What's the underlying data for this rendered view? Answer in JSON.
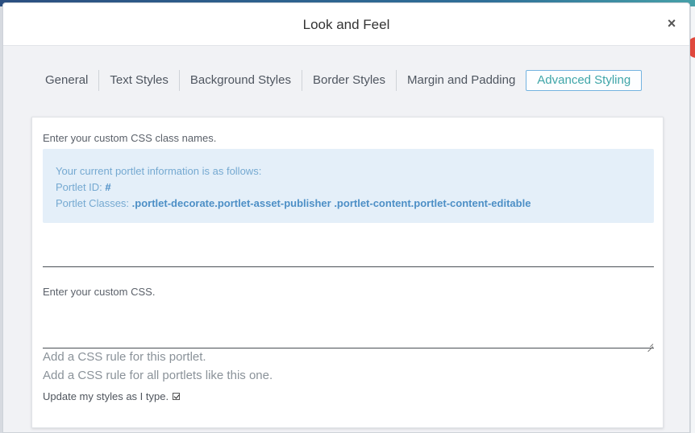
{
  "dialog": {
    "title": "Look and Feel",
    "close_label": "×"
  },
  "tabs": [
    {
      "label": "General",
      "active": false
    },
    {
      "label": "Text Styles",
      "active": false
    },
    {
      "label": "Background Styles",
      "active": false
    },
    {
      "label": "Border Styles",
      "active": false
    },
    {
      "label": "Margin and Padding",
      "active": false
    },
    {
      "label": "Advanced Styling",
      "active": true
    }
  ],
  "advanced": {
    "class_names_label": "Enter your custom CSS class names.",
    "info": {
      "heading": "Your current portlet information is as follows:",
      "portlet_id_label": "Portlet ID:",
      "portlet_id_value": "#",
      "portlet_classes_label": "Portlet Classes:",
      "portlet_classes_value": ".portlet-decorate.portlet-asset-publisher .portlet-content.portlet-content-editable"
    },
    "class_names_value": "",
    "custom_css_label": "Enter your custom CSS.",
    "custom_css_value": "",
    "add_rule_this": "Add a CSS rule for this portlet.",
    "add_rule_all": "Add a CSS rule for all portlets like this one.",
    "update_styles_label": "Update my styles as I type.",
    "update_styles_checked": true
  },
  "colors": {
    "accent": "#3ea5a8",
    "info_bg": "#e4eff9",
    "info_text": "#75a9d1"
  }
}
